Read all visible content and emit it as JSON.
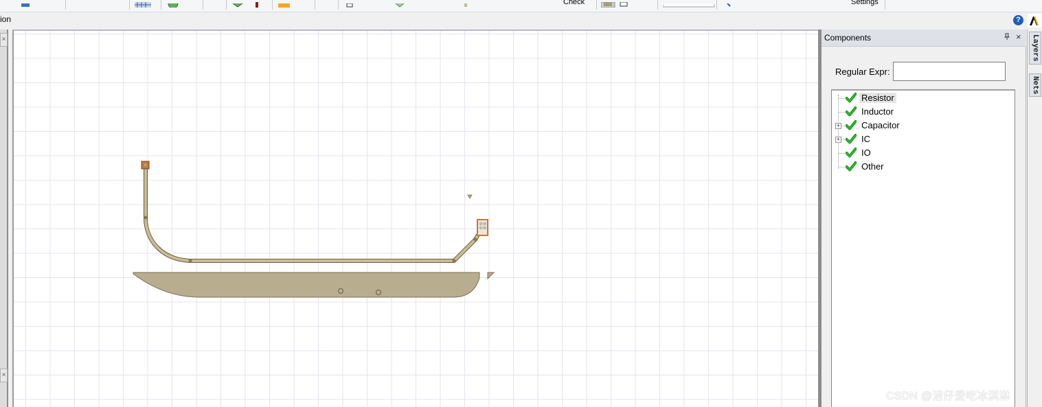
{
  "toolbar": {
    "check_label": "Check",
    "settings_label": "Settings"
  },
  "strip": {
    "left_text": "ion",
    "help_label": "?"
  },
  "left_dock": {
    "close_glyph": "×"
  },
  "components_panel": {
    "title": "Components",
    "pin_glyph": "🖈",
    "close_glyph": "×",
    "regex_label": "Regular Expr:",
    "regex_value": "",
    "tree": [
      {
        "label": "Resistor",
        "has_children": false,
        "checked": true,
        "selected": true
      },
      {
        "label": "Inductor",
        "has_children": false,
        "checked": true,
        "selected": false
      },
      {
        "label": "Capacitor",
        "has_children": true,
        "checked": true,
        "selected": false
      },
      {
        "label": "IC",
        "has_children": true,
        "checked": true,
        "selected": false
      },
      {
        "label": "IO",
        "has_children": false,
        "checked": true,
        "selected": false
      },
      {
        "label": "Other",
        "has_children": false,
        "checked": true,
        "selected": false
      }
    ]
  },
  "side_tabs": {
    "layers_label": "Layers",
    "nets_label": "Nets"
  },
  "colors": {
    "trace": "#b4a98a",
    "trace_outline": "#6b5e3c",
    "pad": "#c8763a",
    "check_green": "#2fb52f"
  },
  "watermark": "CSDN @洁仔爱吃冰淇淋"
}
